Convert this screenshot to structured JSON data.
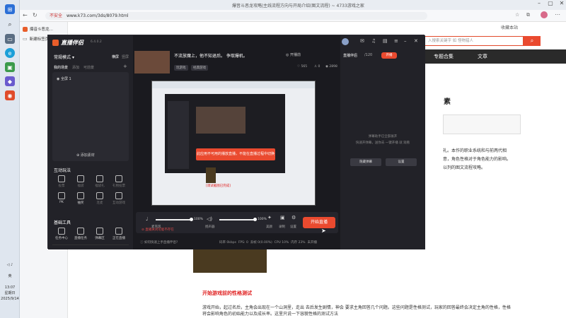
{
  "browser": {
    "tab_title": "爆音斗恶龙攻略|主线流程方向与开局介绍(图文流程) ~ 4733游戏之家",
    "url_prefix": "不安全",
    "url": "www.k73.com/3ds/8079.html",
    "new_tab_label": "新建标签页"
  },
  "taskbar": {
    "lang": "英",
    "time": "13:07",
    "weekday": "星期日",
    "date": "2025/9/14"
  },
  "site": {
    "header_link": "收藏本站",
    "search_placeholder": "入搜索关键字 如 怪物猎人",
    "nav": [
      "专题合集",
      "文章"
    ],
    "heading_fragment": "素",
    "red_heading": "开始游戏前的性格测试",
    "paragraph": "游戏开始，起过名后，主角会出现在一个山洞里，走出 去后发生剧情，神会 要求主角回答几个问题。这些问题是性格测试，玩家的回答最终会决定主角的性格，性格将会影响角色的初始能力以及成长率。这里只说一下容貌性格的测试方法",
    "right_text_1": "礼。本作的职业系统和与前两代相",
    "right_text_2": "意，角色性格对于角色能力的影响。",
    "right_text_3": "以列的图文流程攻略。",
    "caption": "[调试截图已完成]"
  },
  "app": {
    "name": "直播伴侣",
    "version": "6.4.0.2",
    "mode_label": "常规模式",
    "tabs": [
      "横屏",
      "竖屏"
    ],
    "scene_tabs": [
      "我的场景",
      "添加",
      "可前景"
    ],
    "scene_item": "全屏 1",
    "add_material": "添加素材",
    "interact_title": "互动玩法",
    "interact_tools": [
      "投票",
      "福袋",
      "福袋礼",
      "礼物投票",
      "PK",
      "抽奖",
      "连麦",
      "互动游戏"
    ],
    "basic_title": "基础工具",
    "basic_tools": [
      "任务中心",
      "直播任务",
      "弹幕区",
      "正在直播",
      "弹幕",
      "直播助手",
      "礼物",
      "下播提醒"
    ],
    "more_label": "更多功能",
    "live_title": "不流放魔上，他不知退后。 争取爆机。",
    "game_tag": "玩游戏",
    "game_name": "经典游戏",
    "stats": {
      "likes": "565",
      "comments": "0",
      "views": "2898"
    },
    "top_actions": [
      "开播前",
      "直播伴侣"
    ],
    "dialog_text": "此应用不可用的播放直播，不能在直播过程中切换",
    "dialog_button": "我知道了",
    "hint_text": "直播关闭可能不存在",
    "mic_label": "麦克风",
    "mic_pct": "100%",
    "speaker_label": "扬声器",
    "speaker_pct": "100%",
    "btn_beauty": "美颜",
    "btn_record": "录制",
    "btn_settings": "设置",
    "start_live": "开始直播",
    "footer_left": "如何快速上手直播伴侣?",
    "status": [
      "码率 0kbps",
      "FPS: 0",
      "丢帧 0(0.00%)",
      "CPU 10%",
      "内存 23%",
      "未开播"
    ],
    "right_header": [
      "开播",
      "/120"
    ],
    "right_text_1": "弹幕助手已全部展开",
    "right_text_2": "快速开弹幕，送你去 一键开播 就 观看",
    "right_btn_1": "隐藏弹幕",
    "right_btn_2": "设置"
  }
}
